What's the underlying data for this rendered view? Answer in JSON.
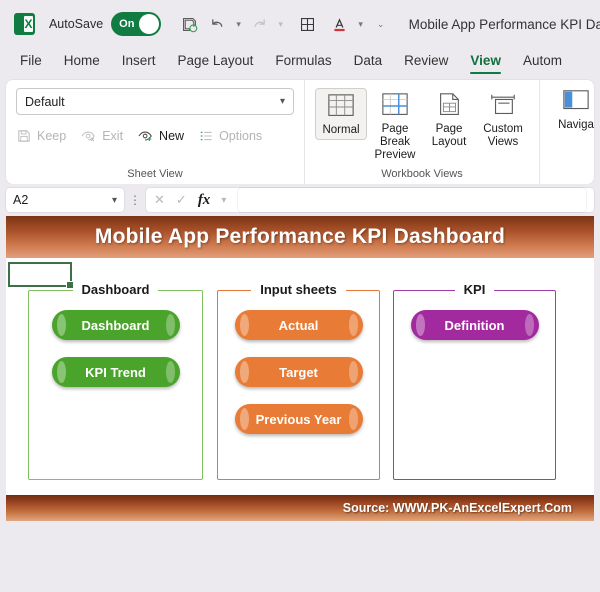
{
  "titlebar": {
    "logo_name": "excel-logo",
    "autosave_label": "AutoSave",
    "autosave_state": "On",
    "document_title": "Mobile App Performance KPI Das",
    "quick_access": [
      {
        "name": "save-icon",
        "glyph": "save"
      },
      {
        "name": "undo-icon",
        "glyph": "undo"
      },
      {
        "name": "redo-icon",
        "glyph": "redo"
      },
      {
        "name": "borders-icon",
        "glyph": "grid"
      },
      {
        "name": "font-color-icon",
        "glyph": "A"
      },
      {
        "name": "customize-quick-access-toolbar-icon",
        "glyph": "chevron"
      }
    ]
  },
  "ribbon": {
    "tabs": [
      {
        "label": "File",
        "active": false
      },
      {
        "label": "Home",
        "active": false
      },
      {
        "label": "Insert",
        "active": false
      },
      {
        "label": "Page Layout",
        "active": false
      },
      {
        "label": "Formulas",
        "active": false
      },
      {
        "label": "Data",
        "active": false
      },
      {
        "label": "Review",
        "active": false
      },
      {
        "label": "View",
        "active": true
      },
      {
        "label": "Autom",
        "active": false
      }
    ],
    "sheet_view": {
      "group_label": "Sheet View",
      "select_value": "Default",
      "buttons": [
        {
          "label": "Keep",
          "enabled": false,
          "icon": "save-icon"
        },
        {
          "label": "Exit",
          "enabled": false,
          "icon": "eye-exit-icon"
        },
        {
          "label": "New",
          "enabled": true,
          "icon": "eye-plus-icon"
        },
        {
          "label": "Options",
          "enabled": false,
          "icon": "list-icon"
        }
      ]
    },
    "workbook_views": {
      "group_label": "Workbook Views",
      "buttons": [
        {
          "label": "Normal",
          "icon": "normal-view-icon",
          "selected": true
        },
        {
          "label": "Page Break Preview",
          "icon": "page-break-preview-icon",
          "selected": false
        },
        {
          "label": "Page Layout",
          "icon": "page-layout-icon",
          "selected": false
        },
        {
          "label": "Custom Views",
          "icon": "custom-views-icon",
          "selected": false
        }
      ]
    },
    "navigation": {
      "label": "Naviga",
      "icon": "navigation-pane-icon"
    }
  },
  "formula_bar": {
    "name_box_value": "A2",
    "cancel_icon": "cancel-icon",
    "enter_icon": "confirm-icon",
    "function_icon": "insert-function-icon",
    "formula_value": ""
  },
  "dashboard": {
    "banner_title": "Mobile App Performance KPI Dashboard",
    "selected_cell": "A2",
    "groups": [
      {
        "title": "Dashboard",
        "color": "#7fbf5f",
        "buttons": [
          {
            "label": "Dashboard",
            "color": "#4aa32a"
          },
          {
            "label": "KPI Trend",
            "color": "#4aa32a"
          }
        ]
      },
      {
        "title": "Input sheets",
        "color": "#e2763c",
        "buttons": [
          {
            "label": "Actual",
            "color": "#e87b35"
          },
          {
            "label": "Target",
            "color": "#e87b35"
          },
          {
            "label": "Previous Year",
            "color": "#e87b35"
          }
        ]
      },
      {
        "title": "KPI",
        "color": "#a33caa",
        "buttons": [
          {
            "label": "Definition",
            "color": "#a32a9e"
          }
        ]
      }
    ],
    "footer_source": "Source: WWW.PK-AnExcelExpert.Com"
  }
}
